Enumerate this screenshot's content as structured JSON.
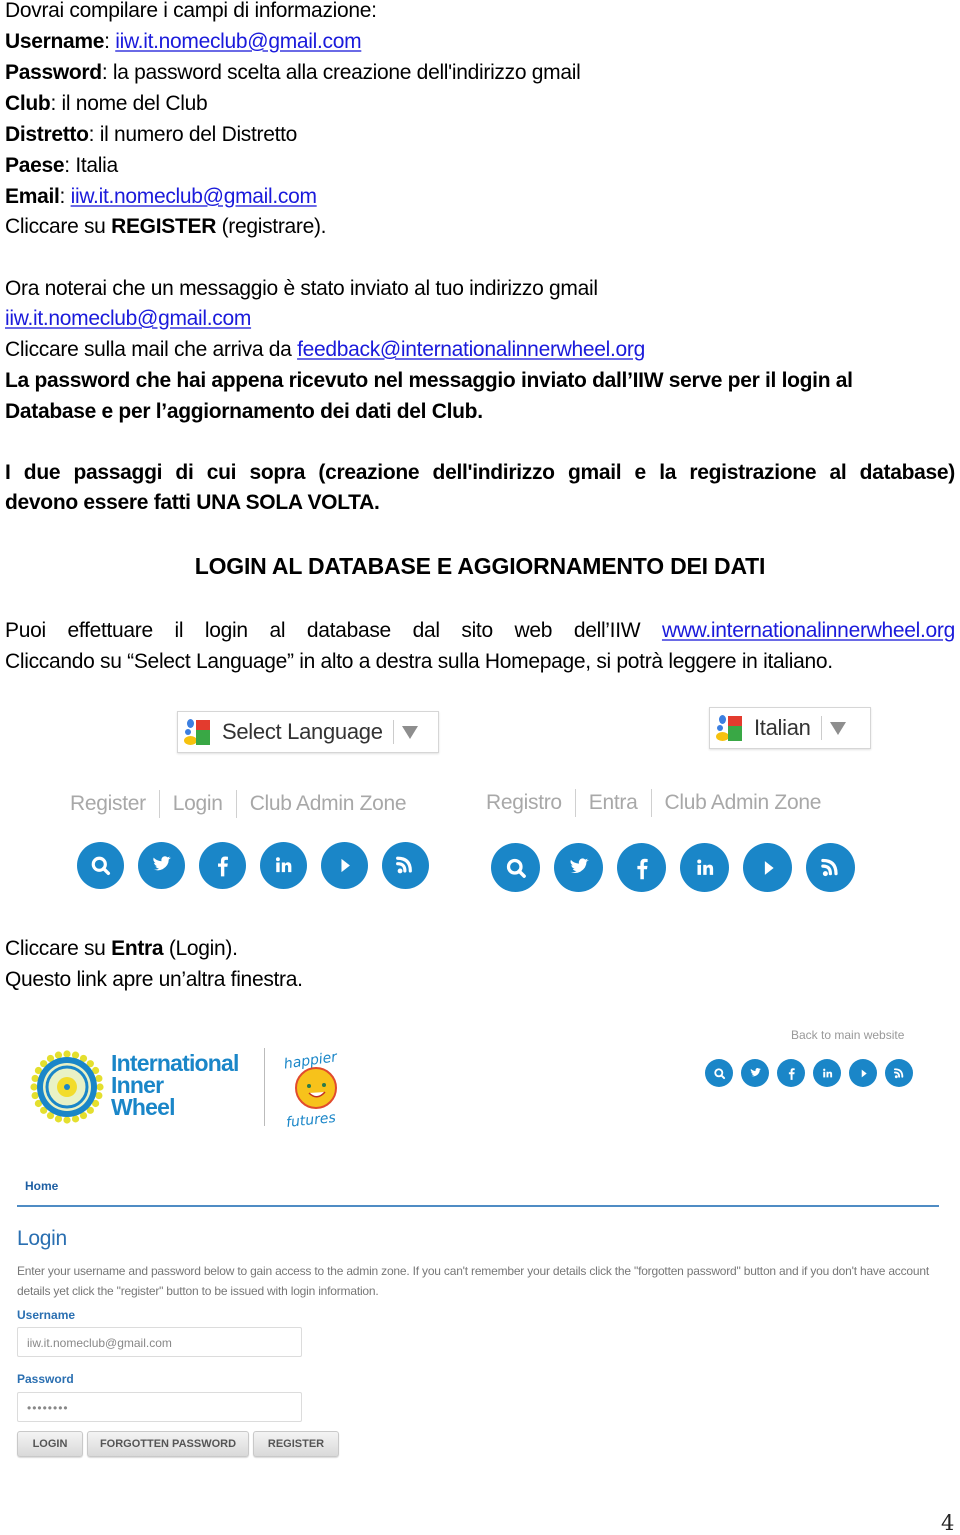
{
  "intro": {
    "line1": "Dovrai compilare i campi di informazione:",
    "fields": [
      {
        "label": "Username",
        "sep": ": ",
        "value": "iiw.it.nomeclub@gmail.com",
        "is_link": true
      },
      {
        "label": "Password",
        "sep": ": ",
        "value": "la password scelta alla creazione dell'indirizzo gmail",
        "is_link": false
      },
      {
        "label": "Club",
        "sep": ": ",
        "value": "il nome del Club",
        "is_link": false
      },
      {
        "label": "Distretto",
        "sep": ": ",
        "value": "il numero del Distretto",
        "is_link": false
      },
      {
        "label": "Paese",
        "sep": ": ",
        "value": "Italia",
        "is_link": false
      },
      {
        "label": "Email",
        "sep": ": ",
        "value": "iiw.it.nomeclub@gmail.com",
        "is_link": true
      }
    ],
    "register_pre": "Cliccare su ",
    "register_bold": "REGISTER",
    "register_post": " (registrare)."
  },
  "message": {
    "line1": "Ora noterai che un messaggio è stato inviato al tuo indirizzo gmail",
    "email_link": "iiw.it.nomeclub@gmail.com",
    "click_pre": "Cliccare sulla mail che arriva da ",
    "feedback_link": "feedback@internationalinnerwheel.org",
    "bold_line1": "La password che hai appena ricevuto nel messaggio inviato dall’IIW serve per il login al",
    "bold_line2": "Database e per l’aggiornamento dei dati del Club."
  },
  "once": {
    "line1": "I due passaggi di cui sopra (creazione dell'indirizzo gmail e la registrazione al database)",
    "line2": "devono essere fatti UNA SOLA VOLTA."
  },
  "section_heading": "LOGIN AL DATABASE E AGGIORNAMENTO DEI DATI",
  "login_info": {
    "line1_pre": "Puoi effettuare il login al database dal sito web dell’IIW ",
    "site_link": "www.internationalinnerwheel.org",
    "line2": "Cliccando su “Select Language” in alto a destra sulla Homepage, si potrà leggere in italiano."
  },
  "screenshot_english": {
    "language_select": "Select Language",
    "nav": [
      "Register",
      "Login",
      "Club Admin Zone"
    ]
  },
  "screenshot_italian": {
    "language_select": "Italian",
    "nav": [
      "Registro",
      "Entra",
      "Club Admin Zone"
    ]
  },
  "social_icons": [
    "search-icon",
    "twitter-icon",
    "facebook-icon",
    "linkedin-icon",
    "play-icon",
    "rss-icon"
  ],
  "entra": {
    "line1_pre": "Cliccare su ",
    "line1_bold": "Entra",
    "line1_post": " (Login).",
    "line2": "Questo link apre un’altra finestra."
  },
  "login_page": {
    "logo_text": [
      "International",
      "Inner",
      "Wheel"
    ],
    "happy_top": "happier",
    "happy_bottom": "futures",
    "back_link": "Back to main website",
    "breadcrumb": "Home",
    "title": "Login",
    "description": "Enter your username and password below to gain access to the admin zone. If you can't remember your details click the \"forgotten password\" button and if you don't have account details yet click the \"register\" button to be issued with login information.",
    "username_label": "Username",
    "username_value": "iiw.it.nomeclub@gmail.com",
    "password_label": "Password",
    "password_value": "••••••••",
    "buttons": [
      "LOGIN",
      "FORGOTTEN PASSWORD",
      "REGISTER"
    ]
  },
  "colors": {
    "link": "#1a1adb",
    "brand_blue": "#1a86c8",
    "heading_blue": "#2a6fb1",
    "nav_gray": "#a8a8a8"
  },
  "page_number": "4"
}
